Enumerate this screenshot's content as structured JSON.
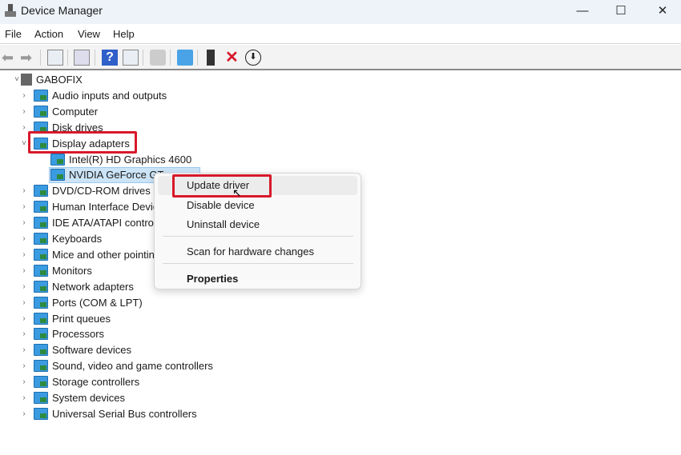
{
  "window": {
    "title": "Device Manager",
    "minimize": "—",
    "maximize": "☐",
    "close": "✕"
  },
  "menubar": [
    "File",
    "Action",
    "View",
    "Help"
  ],
  "toolbar": [
    "back-icon",
    "forward-icon",
    "show-hide-console-tree-icon",
    "properties-icon",
    "help-icon",
    "action-pane-icon",
    "update-driver-icon",
    "scan-hardware-icon",
    "add-legacy-hardware-icon",
    "uninstall-icon",
    "disable-icon"
  ],
  "tree": {
    "root": "GABOFIX",
    "categories": [
      {
        "label": "Audio inputs and outputs"
      },
      {
        "label": "Computer"
      },
      {
        "label": "Disk drives"
      },
      {
        "label": "Display adapters",
        "expanded": true,
        "children": [
          "Intel(R) HD Graphics 4600",
          "NVIDIA GeForce GT"
        ]
      },
      {
        "label": "DVD/CD-ROM drives"
      },
      {
        "label": "Human Interface Devices"
      },
      {
        "label": "IDE ATA/ATAPI controllers"
      },
      {
        "label": "Keyboards"
      },
      {
        "label": "Mice and other pointing devices"
      },
      {
        "label": "Monitors"
      },
      {
        "label": "Network adapters"
      },
      {
        "label": "Ports (COM & LPT)"
      },
      {
        "label": "Print queues"
      },
      {
        "label": "Processors"
      },
      {
        "label": "Software devices"
      },
      {
        "label": "Sound, video and game controllers"
      },
      {
        "label": "Storage controllers"
      },
      {
        "label": "System devices"
      },
      {
        "label": "Universal Serial Bus controllers"
      }
    ]
  },
  "context_menu": {
    "items": [
      "Update driver",
      "Disable device",
      "Uninstall device",
      "Scan for hardware changes",
      "Properties"
    ]
  },
  "colors": {
    "highlight": "#d7192a",
    "selection": "#cce4f7"
  }
}
